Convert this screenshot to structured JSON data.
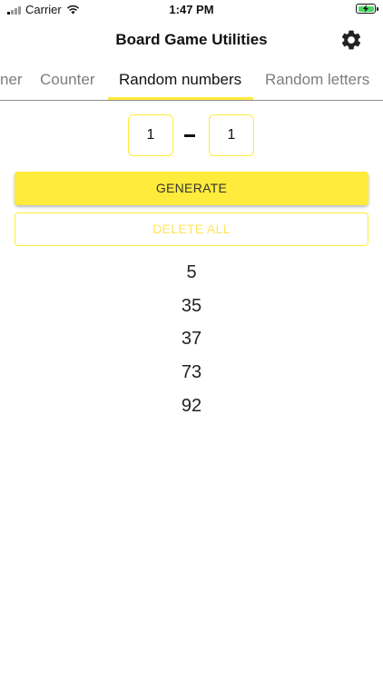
{
  "status_bar": {
    "carrier": "Carrier",
    "time": "1:47 PM"
  },
  "nav": {
    "title": "Board Game Utilities",
    "settings_icon": "gear-icon"
  },
  "tabs": [
    {
      "label": "Timer",
      "visible_fragment": "ner",
      "active": false
    },
    {
      "label": "Counter",
      "active": false
    },
    {
      "label": "Random numbers",
      "active": true
    },
    {
      "label": "Random letters",
      "active": false
    }
  ],
  "range": {
    "min_value": "1",
    "separator": "–",
    "max_value": "1"
  },
  "buttons": {
    "generate_label": "GENERATE",
    "delete_all_label": "DELETE ALL"
  },
  "results": [
    "5",
    "35",
    "37",
    "73",
    "92"
  ],
  "colors": {
    "accent": "#ffeb3b",
    "battery_fill": "#4cd964",
    "inactive_tab": "#7d7d7d"
  }
}
